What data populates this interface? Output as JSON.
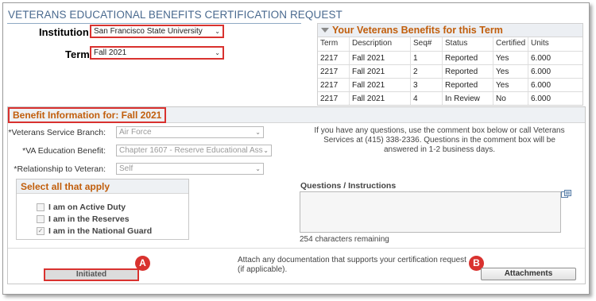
{
  "page": {
    "title": "VETERANS EDUCATIONAL BENEFITS CERTIFICATION REQUEST"
  },
  "institution": {
    "label": "Institution",
    "value": "San Francisco State University"
  },
  "term": {
    "label": "Term",
    "value": "Fall 2021"
  },
  "benefits_grid": {
    "title": "Your Veterans Benefits for this Term",
    "columns": [
      "Term",
      "Description",
      "Seq#",
      "Status",
      "Certified",
      "Units"
    ],
    "rows": [
      [
        "2217",
        "Fall 2021",
        "1",
        "Reported",
        "Yes",
        "6.000"
      ],
      [
        "2217",
        "Fall 2021",
        "2",
        "Reported",
        "Yes",
        "6.000"
      ],
      [
        "2217",
        "Fall 2021",
        "3",
        "Reported",
        "Yes",
        "6.000"
      ],
      [
        "2217",
        "Fall 2021",
        "4",
        "In Review",
        "No",
        "6.000"
      ]
    ]
  },
  "benefit_info": {
    "header": "Benefit Information for: Fall 2021",
    "service_branch": {
      "label": "*Veterans Service Branch:",
      "value": "Air Force"
    },
    "education_benefit": {
      "label": "*VA Education Benefit:",
      "value": "Chapter 1607 - Reserve Educational Assi"
    },
    "relationship": {
      "label": "*Relationship to Veteran:",
      "value": "Self"
    },
    "info_text": "If you have any questions, use the comment box below or call Veterans Services at (415) 338-2336. Questions in the comment box will be answered in 1-2 business days.",
    "select_all": {
      "title": "Select all that apply",
      "options": [
        {
          "label": "I am on Active Duty",
          "checked": false
        },
        {
          "label": "I am in the Reserves",
          "checked": false
        },
        {
          "label": "I am in the National Guard",
          "checked": true
        }
      ]
    },
    "questions": {
      "label": "Questions / Instructions",
      "chars_remaining": "254 characters remaining"
    }
  },
  "footer": {
    "status_button": "Initiated",
    "attach_note": "Attach any documentation that supports your certification request (if applicable).",
    "attachments_button": "Attachments"
  },
  "callouts": {
    "a": "A",
    "b": "B"
  },
  "colors": {
    "accent_orange": "#c15e0c",
    "highlight_red": "#d9322f",
    "title_blue": "#4a6a8f"
  }
}
